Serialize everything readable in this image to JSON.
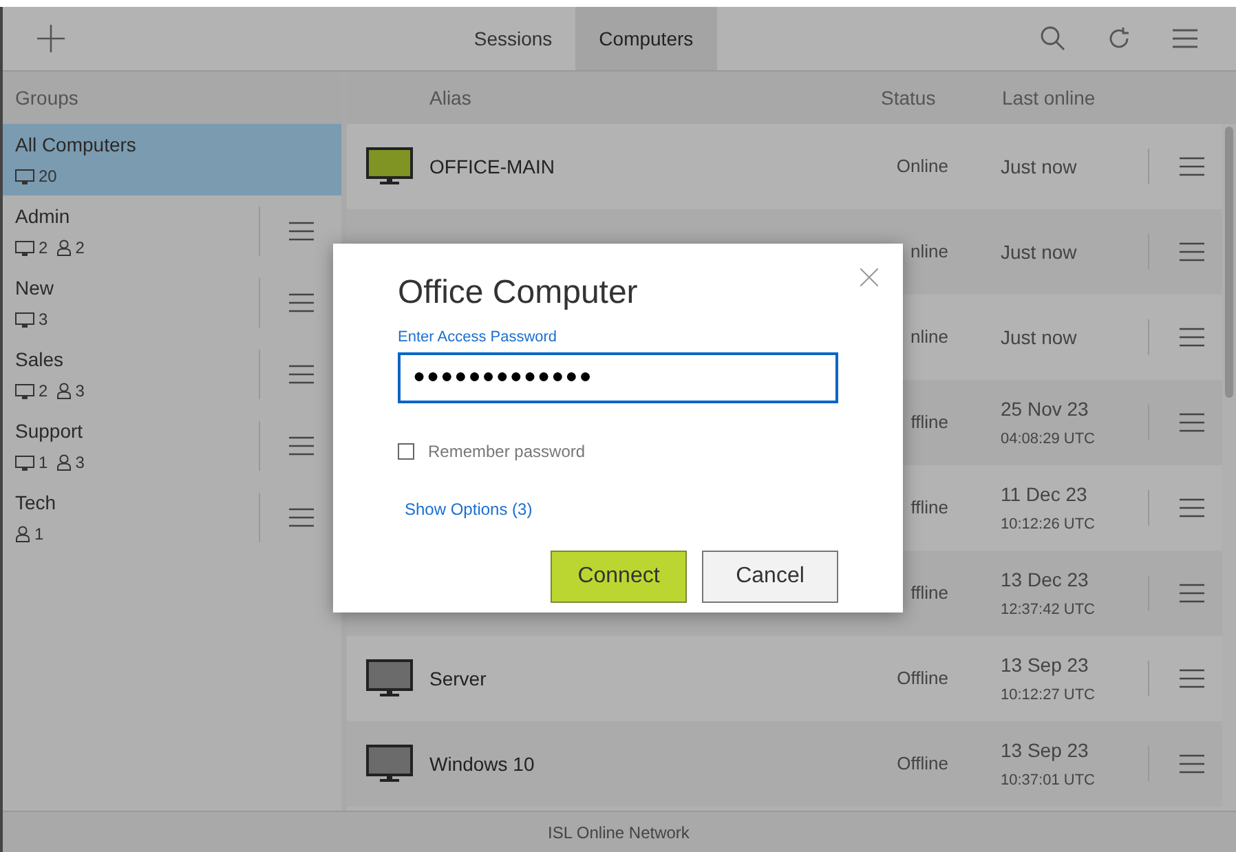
{
  "tabs": [
    {
      "label": "Sessions",
      "selected": false
    },
    {
      "label": "Computers",
      "selected": true
    }
  ],
  "sidebar": {
    "header": "Groups",
    "items": [
      {
        "name": "All Computers",
        "computers": "20",
        "selected": true
      },
      {
        "name": "Admin",
        "computers": "2",
        "users": "2",
        "selected": false
      },
      {
        "name": "New",
        "computers": "3",
        "selected": false
      },
      {
        "name": "Sales",
        "computers": "2",
        "users": "3",
        "selected": false
      },
      {
        "name": "Support",
        "computers": "1",
        "users": "3",
        "selected": false
      },
      {
        "name": "Tech",
        "users": "1",
        "selected": false
      }
    ]
  },
  "table": {
    "columns": [
      "Alias",
      "Status",
      "Last online"
    ],
    "rows": [
      {
        "alias": "OFFICE-MAIN",
        "online": true,
        "status": "Online",
        "date": "Just now"
      },
      {
        "status": "nline",
        "date": "Just now"
      },
      {
        "status": "nline",
        "date": "Just now"
      },
      {
        "status": "ffline",
        "date": "25 Nov 23",
        "time": "04:08:29 UTC"
      },
      {
        "status": "ffline",
        "date": "11 Dec 23",
        "time": "10:12:26 UTC"
      },
      {
        "status": "ffline",
        "date": "13 Dec 23",
        "time": "12:37:42 UTC"
      },
      {
        "alias": "Server",
        "online": false,
        "status": "Offline",
        "date": "13 Sep 23",
        "time": "10:12:27 UTC"
      },
      {
        "alias": "Windows 10",
        "online": false,
        "status": "Offline",
        "date": "13 Sep 23",
        "time": "10:37:01 UTC"
      }
    ]
  },
  "dialog": {
    "title": "Office Computer",
    "password_label": "Enter Access Password",
    "password_value": "●●●●●●●●●●●●●",
    "remember": {
      "label": "Remember password",
      "checked": false
    },
    "options_link": "Show Options (3)",
    "buttons": [
      {
        "label": "Connect",
        "kind": "primary"
      },
      {
        "label": "Cancel",
        "kind": "secondary"
      }
    ]
  },
  "footer": "ISL Online Network"
}
